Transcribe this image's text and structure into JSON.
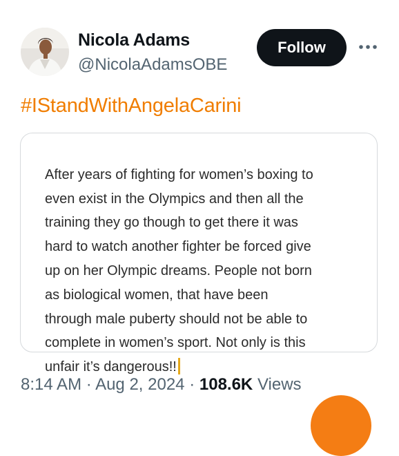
{
  "tweet": {
    "author": {
      "name": "Nicola Adams",
      "handle": "@NicolaAdamsOBE",
      "avatar_icon": "profile-photo"
    },
    "follow_label": "Follow",
    "more_icon": "more-horizontal-icon",
    "hashtag": "#IStandWithAngelaCarini",
    "quote_lines": [
      "After years of fighting for women’s boxing to",
      "even exist in the Olympics and then all the",
      "training they go though to get there it was",
      "hard to watch another fighter be forced give",
      "up on her Olympic dreams. People not born",
      "as biological women, that have been",
      "through male puberty should not be able to",
      "complete in women’s sport. Not only is this",
      "unfair it’s dangerous!!"
    ],
    "time": "8:14 AM",
    "separator": "·",
    "date": "Aug 2, 2024",
    "views_count": "108.6K",
    "views_label": "Views"
  },
  "colors": {
    "hashtag": "#f07d00",
    "follow_bg": "#0f1419",
    "fab": "#f47d14",
    "caret": "#e5a91b",
    "secondary_text": "#536471"
  }
}
